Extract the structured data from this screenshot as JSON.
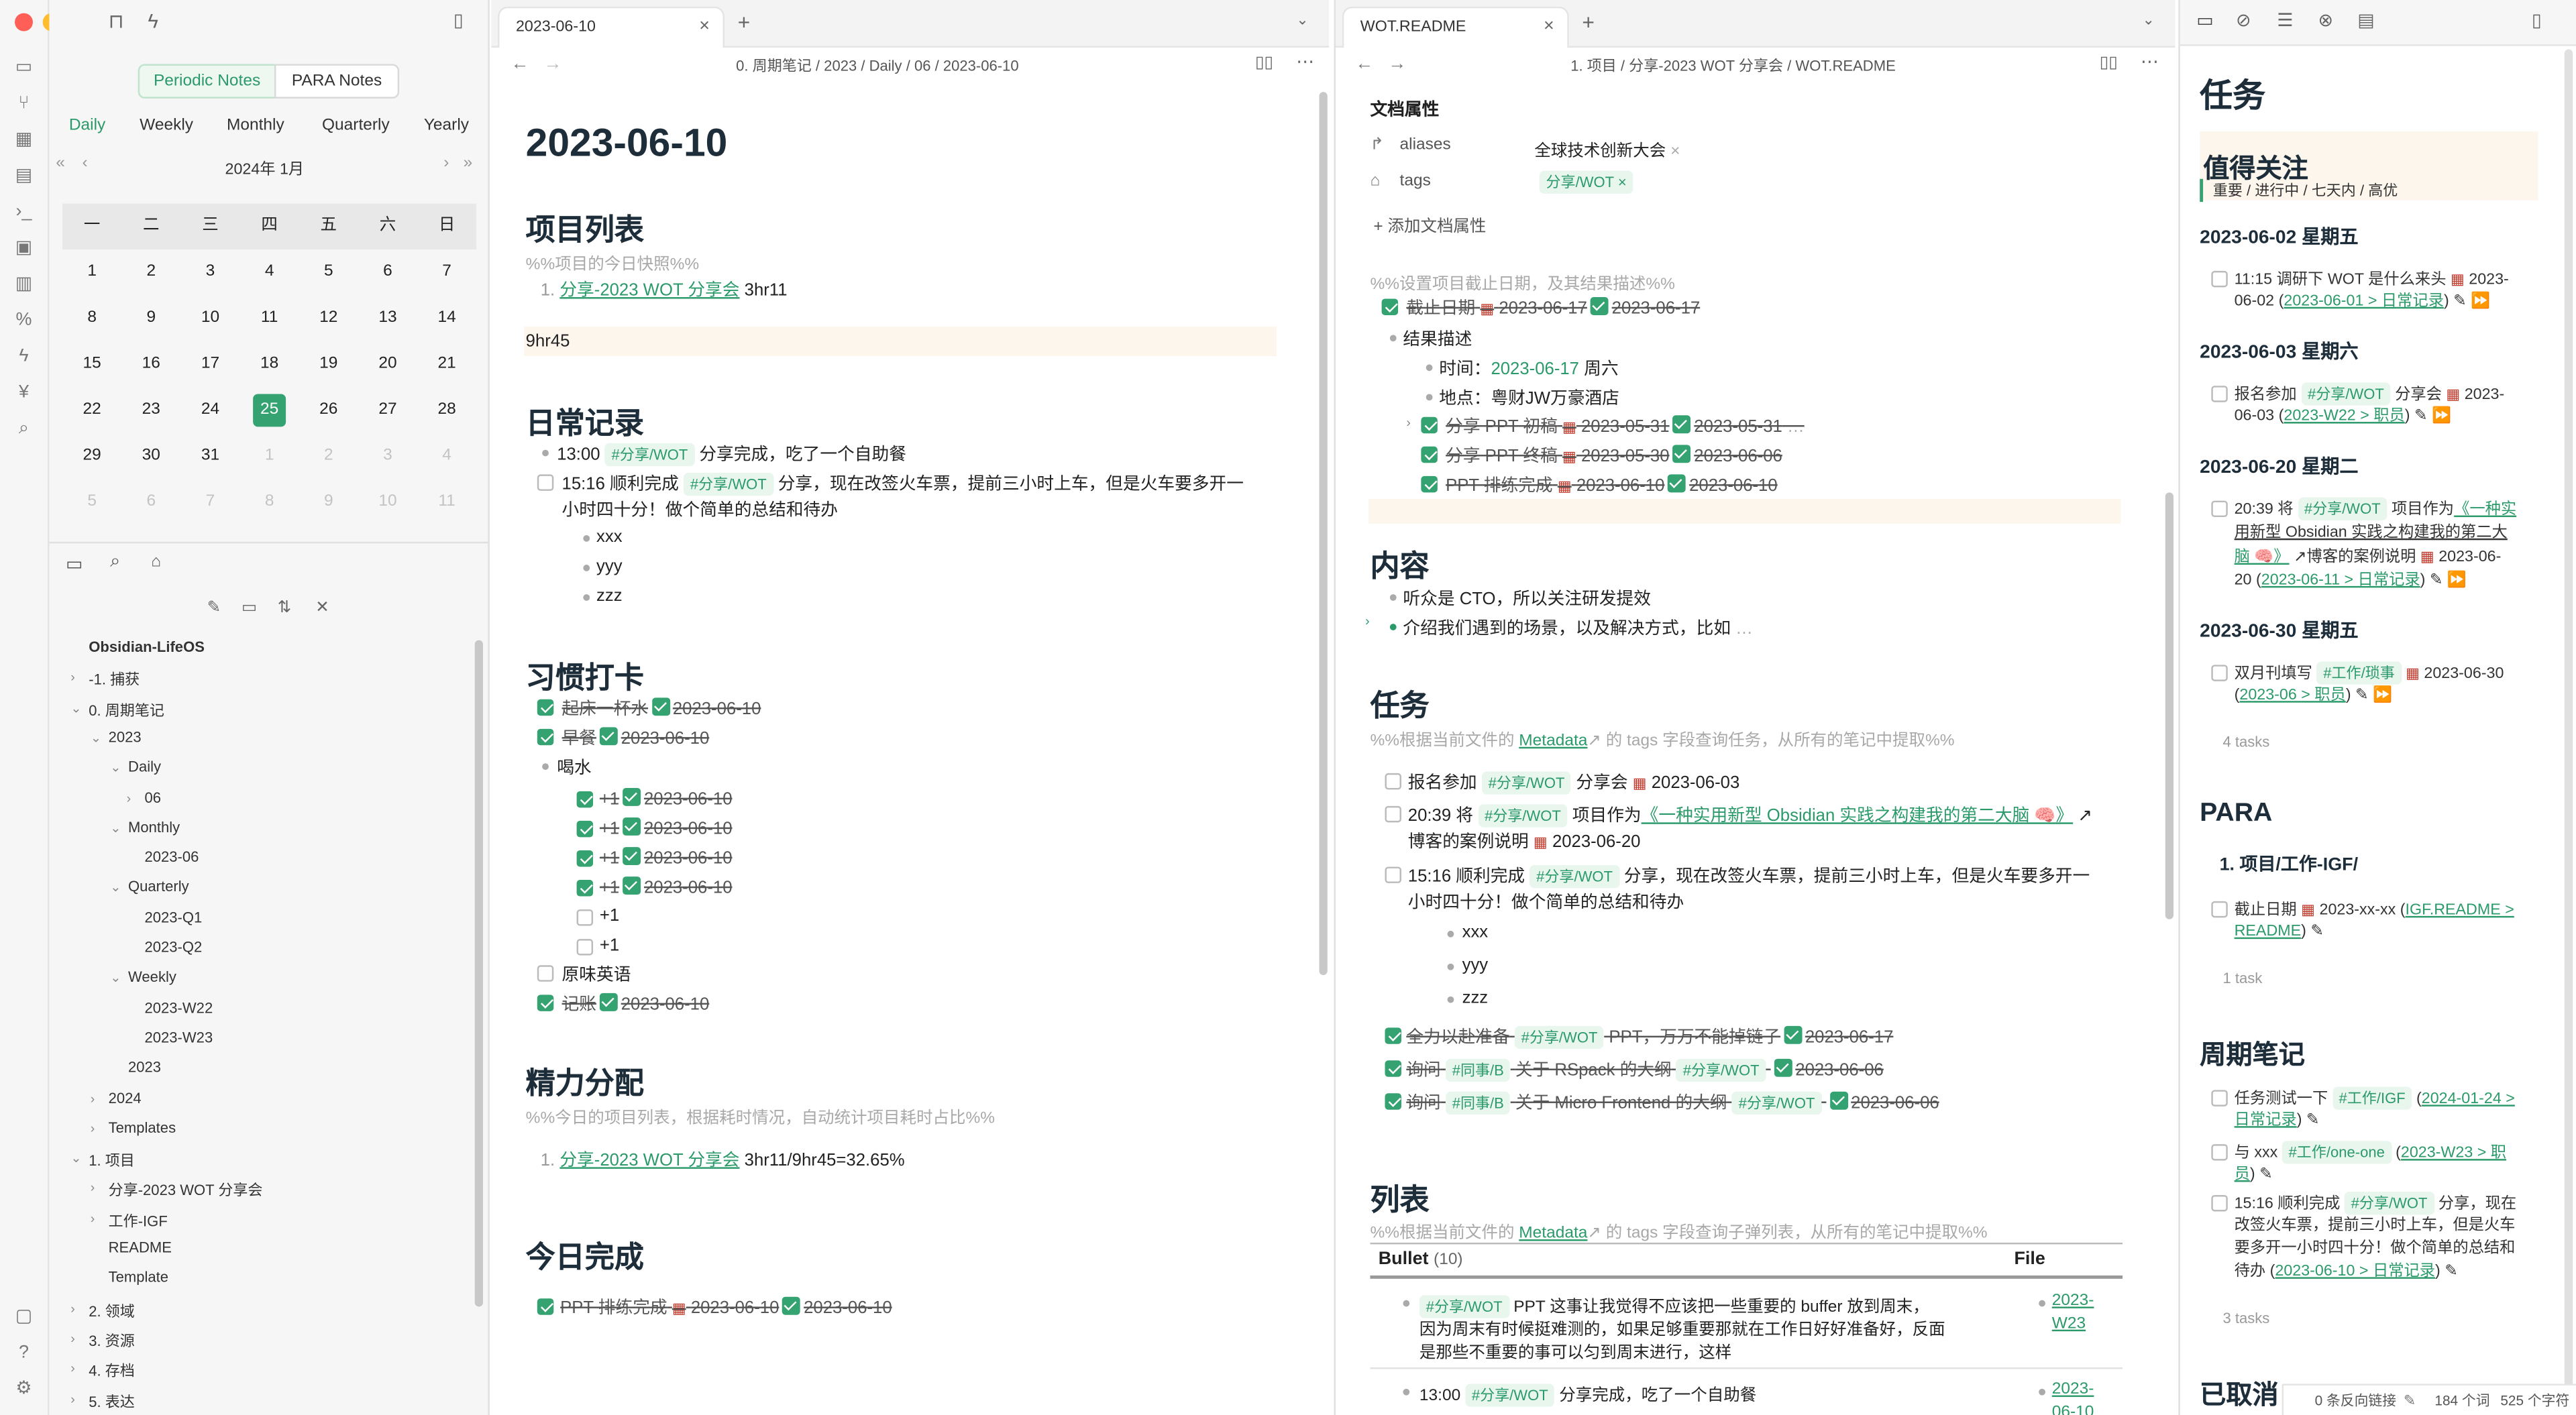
{
  "left_sidebar": {
    "view_tabs": [
      "Periodic Notes",
      "PARA Notes"
    ],
    "period_tabs": [
      "Daily",
      "Weekly",
      "Monthly",
      "Quarterly",
      "Yearly"
    ],
    "calendar": {
      "month_label": "2024年  1月",
      "weekdays": [
        "一",
        "二",
        "三",
        "四",
        "五",
        "六",
        "日"
      ],
      "weeks": [
        [
          "1",
          "2",
          "3",
          "4",
          "5",
          "6",
          "7"
        ],
        [
          "8",
          "9",
          "10",
          "11",
          "12",
          "13",
          "14"
        ],
        [
          "15",
          "16",
          "17",
          "18",
          "19",
          "20",
          "21"
        ],
        [
          "22",
          "23",
          "24",
          "25",
          "26",
          "27",
          "28"
        ],
        [
          "29",
          "30",
          "31",
          "1",
          "2",
          "3",
          "4"
        ],
        [
          "5",
          "6",
          "7",
          "8",
          "9",
          "10",
          "11"
        ]
      ],
      "today": "25"
    },
    "tree": [
      {
        "label": "Obsidian-LifeOS",
        "bold": true
      },
      {
        "label": "-1. 捕获"
      },
      {
        "label": "0. 周期笔记"
      },
      {
        "label": "2023"
      },
      {
        "label": "Daily"
      },
      {
        "label": "06"
      },
      {
        "label": "Monthly"
      },
      {
        "label": "2023-06"
      },
      {
        "label": "Quarterly"
      },
      {
        "label": "2023-Q1"
      },
      {
        "label": "2023-Q2"
      },
      {
        "label": "Weekly"
      },
      {
        "label": "2023-W22"
      },
      {
        "label": "2023-W23"
      },
      {
        "label": "2023"
      },
      {
        "label": "2024"
      },
      {
        "label": "Templates"
      },
      {
        "label": "1. 项目"
      },
      {
        "label": "分享-2023 WOT 分享会"
      },
      {
        "label": "工作-IGF"
      },
      {
        "label": "README"
      },
      {
        "label": "Template"
      },
      {
        "label": "2. 领域"
      },
      {
        "label": "3. 资源"
      },
      {
        "label": "4. 存档"
      },
      {
        "label": "5. 表达"
      }
    ]
  },
  "pane1": {
    "tab_title": "2023-06-10",
    "breadcrumb": "0. 周期笔记 / 2023 / Daily / 06 / 2023-06-10",
    "title": "2023-06-10",
    "h_projects": "项目列表",
    "c_projects": "%%项目的今日快照%%",
    "project_link": "分享-2023 WOT 分享会",
    "project_time": " 3hr11",
    "total": "9hr45",
    "h_daily": "日常记录",
    "d1_time": "13:00",
    "tag_share": "#分享/WOT",
    "d1_text": "分享完成，吃了一个自助餐",
    "d2_a": "15:16 顺利完成",
    "d2_b": "分享，现在改签火车票，提前三小时上车，但是火车要多开一",
    "d2_c": "小时四十分！做个简单的总结和待办",
    "sub": [
      "xxx",
      "yyy",
      "zzz"
    ],
    "h_habit": "习惯打卡",
    "hab1": "起床一杯水",
    "hab2": "早餐",
    "hab3": "喝水",
    "plus": "+1",
    "hab_date": "2023-06-10",
    "hab4": "原味英语",
    "hab5": "记账",
    "h_energy": "精力分配",
    "c_energy": "%%今日的项目列表，根据耗时情况，自动统计项目耗时占比%%",
    "energy_text": " 3hr11/9hr45=32.65%",
    "h_done": "今日完成",
    "done_text": "PPT 排练完成",
    "done_d1": "2023-06-10",
    "done_d2": "2023-06-10"
  },
  "pane2": {
    "tab_title": "WOT.README",
    "breadcrumb": "1. 项目 / 分享-2023 WOT 分享会 / WOT.README",
    "props_title": "文档属性",
    "aliases_key": "aliases",
    "aliases_val": "全球技术创新大会",
    "tags_key": "tags",
    "tags_val": "分享/WOT",
    "add_prop": "添加文档属性",
    "c_deadline": "%%设置项目截止日期，及其结果描述%%",
    "deadline": "截止日期",
    "deadline_d1": "2023-06-17",
    "deadline_d2": "2023-06-17",
    "result": "结果描述",
    "time_label": "时间：",
    "time_date": "2023-06-17",
    "time_day": " 周六",
    "place": "地点：粤财JW万豪酒店",
    "r1": "分享 PPT 初稿",
    "r1d1": "2023-05-31",
    "r1d2": "2023-05-31",
    "r2": "分享 PPT 终稿",
    "r2d1": "2023-05-30",
    "r2d2": "2023-06-06",
    "r3": "PPT 排练完成",
    "r3d1": "2023-06-10",
    "r3d2": "2023-06-10",
    "h_content": "内容",
    "c1": "听众是 CTO，所以关注研发提效",
    "c2": "介绍我们遇到的场景，以及解决方式，比如",
    "h_tasks": "任务",
    "c_tasks_a": "%%根据当前文件的",
    "metadata": "Metadata",
    "c_tasks_b": "的 tags 字段查询任务，从所有的笔记中提取%%",
    "t1a": "报名参加",
    "t1b": "分享会",
    "t1d": "2023-06-03",
    "t2a": "20:39 将",
    "t2b": "项目作为",
    "t2link": "《一种实用新型 Obsidian 实践之构建我的第二大脑 🧠》",
    "t2c": "博客的案例说明",
    "t2d": "2023-06-20",
    "t3a": "15:16 顺利完成",
    "t3b": "分享，现在改签火车票，提前三小时上车，但是火车要多开一",
    "t3c": "小时四十分！做个简单的总结和待办",
    "t4a": "全力以赴准备",
    "t4b": "PPT，万万不能掉链子",
    "t4d": "2023-06-17",
    "t5a": "询问",
    "tag_peer": "#同事/B",
    "t5b": "关于 RSpack 的大纲",
    "t5d": "2023-06-06",
    "t6b": "关于 Micro Frontend 的大纲",
    "t6d": "2023-06-06",
    "h_list": "列表",
    "c_list_b": "的 tags 字段查询子弹列表，从所有的笔记中提取%%",
    "col_bullet": "Bullet",
    "col_count": "(10)",
    "col_file": "File",
    "l1a": "PPT 这事让我觉得不应该把一些重要的 buffer 放到周末，",
    "l1b": "因为周末有时候挺难测的，如果足够重要那就在工作日好好准备好，反面",
    "l1c": "是那些不重要的事可以匀到周末进行，这样",
    "l1f1": "2023-",
    "l1f2": "W23",
    "l2a": "13:00",
    "l2b": "分享完成，吃了一个自助餐",
    "l2f1": "2023-",
    "l2f2": "06-10"
  },
  "right_sidebar": {
    "title": "任务",
    "focus_title": "值得关注",
    "focus_sub": "重要 / 进行中 / 七天内 / 高优",
    "g1": "2023-06-02 星期五",
    "g1_a": "11:15 调研下 WOT 是什么来头",
    "g1_b": "2023-",
    "g1_c": "06-02",
    "g1_link": "2023-06-01 > 日常记录",
    "g2": "2023-06-03 星期六",
    "g2_a": "报名参加",
    "g2_b": "分享会",
    "g2_c": "2023-",
    "g2_d": "06-03",
    "g2_link": "2023-W22 > 职员",
    "g3": "2023-06-20 星期二",
    "g3_a": "20:39 将",
    "g3_b": "项目作为",
    "g3_link1": "《一种实",
    "g3_link2": "用新型 Obsidian 实践之构建我的第二大",
    "g3_link3": "脑 🧠》",
    "g3_c": "博客的案例说明",
    "g3_d": "2023-06-",
    "g3_e": "20",
    "g3_link": "2023-06-11 > 日常记录",
    "g4": "2023-06-30 星期五",
    "g4_a": "双月刊填写",
    "tag_work": "#工作/琐事",
    "g4_d": "2023-06-30",
    "g4_link": "2023-06 > 职员",
    "count1": "4 tasks",
    "para": "PARA",
    "para_1": "1. 项目/工作-IGF/",
    "para_t": "截止日期",
    "para_d": "2023-xx-xx",
    "para_link1": "IGF.README >",
    "para_link2": "README",
    "count2": "1 task",
    "periodic": "周期笔记",
    "p1": "任务测试一下",
    "tag_igf": "#工作/IGF",
    "p1_link1": "2024-01-24 >",
    "p1_link2": "日常记录",
    "p2": "与 xxx",
    "tag_oneone": "#工作/one-one",
    "p2_link1": "2023-W23 > 职",
    "p2_link2": "员",
    "p3a": "15:16 顺利完成",
    "p3b": "分享，现在",
    "p3c": "改签火车票，提前三小时上车，但是火车",
    "p3d": "要多开一小时四十分！做个简单的总结和",
    "p3e": "待办",
    "p3_link": "2023-06-10 > 日常记录",
    "count3": "3 tasks",
    "cancelled": "已取消",
    "status_backlinks": "0 条反向链接",
    "status_words": "184 个词",
    "status_chars": "525 个字符"
  },
  "colors": {
    "accent": "#35a271",
    "link": "#2b9a6a",
    "highlight": "#fdf6ec"
  }
}
